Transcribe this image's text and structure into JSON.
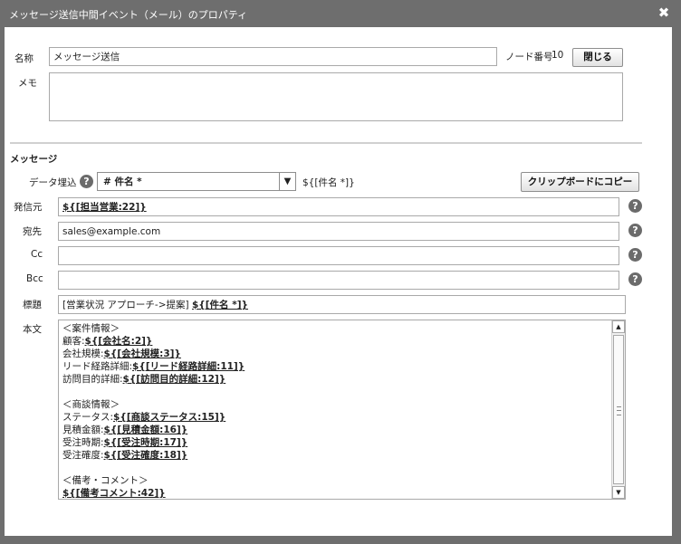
{
  "window": {
    "title": "メッセージ送信中間イベント（メール）のプロパティ",
    "close_glyph": "✖"
  },
  "form": {
    "name_label": "名称",
    "name_value": "メッセージ送信",
    "node_number_label": "ノード番号",
    "node_number_value": "10",
    "close_button": "閉じる",
    "memo_label": "メモ",
    "memo_value": ""
  },
  "message": {
    "section_title": "メッセージ",
    "data_embed_label": "データ埋込",
    "data_select_value": "# 件名 *",
    "data_select_arrow": "▼",
    "data_token_preview": "${[件名 *]}",
    "copy_button": "クリップボードにコピー",
    "sender_label": "発信元",
    "sender_value": "${[担当営業:22]}",
    "to_label": "宛先",
    "to_value": "sales@example.com",
    "cc_label": "Cc",
    "cc_value": "",
    "bcc_label": "Bcc",
    "bcc_value": "",
    "subject_label": "標題",
    "subject_prefix": "[営業状況 アプローチ->提案]",
    "subject_token": "${[件名 *]}",
    "body_label": "本文",
    "body_lines": [
      {
        "text": "＜案件情報＞",
        "token": ""
      },
      {
        "text": "顧客:",
        "token": "${[会社名:2]}"
      },
      {
        "text": "会社規模:",
        "token": "${[会社規模:3]}"
      },
      {
        "text": "リード経路詳細:",
        "token": "${[リード経路詳細:11]}"
      },
      {
        "text": "訪問目的詳細:",
        "token": "${[訪問目的詳細:12]}"
      },
      {
        "text": "",
        "token": ""
      },
      {
        "text": "＜商談情報＞",
        "token": ""
      },
      {
        "text": "ステータス:",
        "token": "${[商談ステータス:15]}"
      },
      {
        "text": "見積金額:",
        "token": "${[見積金額:16]}"
      },
      {
        "text": "受注時期:",
        "token": "${[受注時期:17]}"
      },
      {
        "text": "受注確度:",
        "token": "${[受注確度:18]}"
      },
      {
        "text": "",
        "token": ""
      },
      {
        "text": "＜備考・コメント＞",
        "token": ""
      },
      {
        "text": "",
        "token": "${[備考コメント:42]}"
      }
    ],
    "help_glyph": "?",
    "scroll_up": "▲",
    "scroll_down": "▼"
  }
}
